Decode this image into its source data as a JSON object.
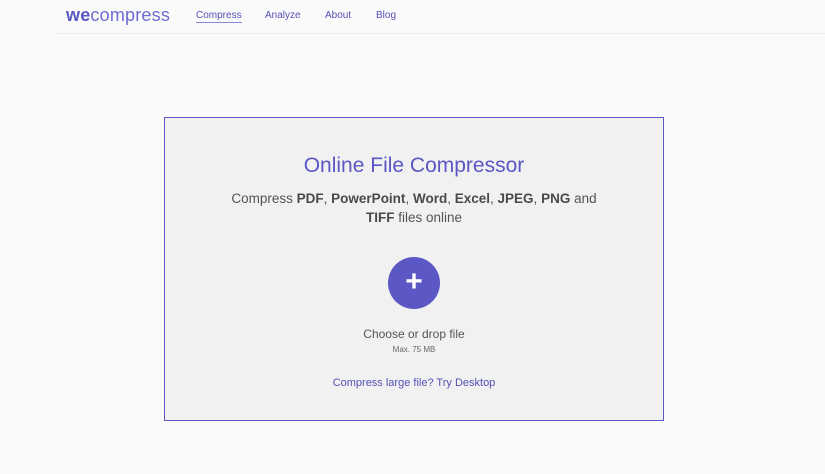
{
  "brand": {
    "logo_bold": "we",
    "logo_rest": "compress",
    "accent_color": "#5b57c4"
  },
  "nav": {
    "items": [
      {
        "label": "Compress",
        "active": true
      },
      {
        "label": "Analyze",
        "active": false
      },
      {
        "label": "About",
        "active": false
      },
      {
        "label": "Blog",
        "active": false
      }
    ]
  },
  "card": {
    "title": "Online File Compressor",
    "subtitle": {
      "prefix": "Compress",
      "formats": [
        "PDF",
        "PowerPoint",
        "Word",
        "Excel",
        "JPEG",
        "PNG"
      ],
      "conjunction": "and",
      "last_format": "TIFF",
      "suffix": "files online"
    },
    "add_button_icon": "plus-icon",
    "add_button_glyph": "+",
    "choose_label": "Choose or drop file",
    "max_size": "Max. 75 MB",
    "desktop_link": "Compress large file? Try Desktop"
  }
}
